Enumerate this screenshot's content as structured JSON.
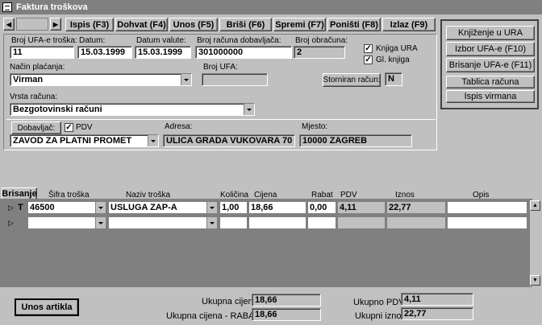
{
  "window": {
    "title": "Faktura troškova"
  },
  "toolbar": {
    "ispis": "Ispis (F3)",
    "dohvat": "Dohvat (F4)",
    "unos": "Unos (F5)",
    "brisi": "Briši (F6)",
    "spremi": "Spremi (F7)",
    "ponisti": "Poništi (F8)",
    "izlaz": "Izlaz (F9)"
  },
  "side": {
    "knjizenje": "Knjiženje u URA",
    "izbor": "Izbor UFA-e (F10)",
    "brisanje": "Brisanje UFA-e (F11)",
    "tablica": "Tablica računa",
    "ispis_virmana": "Ispis virmana"
  },
  "form": {
    "broj_ufa_label": "Broj UFA-e troška:",
    "broj_ufa": "11",
    "datum_label": "Datum:",
    "datum": "15.03.1999",
    "datum_valute_label": "Datum valute:",
    "datum_valute": "15.03.1999",
    "broj_racuna_label": "Broj računa dobavljača:",
    "broj_racuna": "301000000",
    "broj_obracuna_label": "Broj obračuna:",
    "broj_obracuna": "2",
    "knjiga_ura": "Knjiga URA",
    "gl_knjiga": "Gl. knjiga",
    "nacin_placanja_label": "Način plaćanja:",
    "nacin_placanja": "Virman",
    "broj_ufa2_label": "Broj UFA:",
    "broj_ufa2": "",
    "storniran_label": "Storniran račun:",
    "storniran": "N",
    "vrsta_racuna_label": "Vrsta računa:",
    "vrsta_racuna": "Bezgotovinski računi",
    "dobavljac_btn": "Dobavljač:",
    "pdv_chk": "PDV",
    "dobavljac": "ZAVOD ZA PLATNI PROMET",
    "adresa_label": "Adresa:",
    "adresa": "ULICA GRADA VUKOVARA 70",
    "mjesto_label": "Mjesto:",
    "mjesto": "10000 ZAGREB"
  },
  "grid": {
    "brisanje": "Brisanje",
    "headers": [
      "Šifra troška",
      "Naziv troška",
      "Količina",
      "Cijena",
      "Rabat",
      "PDV",
      "Iznos",
      "Opis"
    ],
    "rows": [
      {
        "marker": "T",
        "sifra": "46500",
        "naziv": "USLUGA ZAP-A",
        "kolicina": "1,00",
        "cijena": "18,66",
        "rabat": "0,00",
        "pdv": "4,11",
        "iznos": "22,77",
        "opis": ""
      }
    ]
  },
  "footer": {
    "unos_artikla": "Unos artikla",
    "ukupna_cijena_label": "Ukupna cijena:",
    "ukupna_cijena": "18,66",
    "ukupna_rabat_label": "Ukupna cijena - RABAT:",
    "ukupna_rabat": "18,66",
    "ukupno_pdv_label": "Ukupno PDV:",
    "ukupno_pdv": "4,11",
    "ukupni_iznos_label": "Ukupni iznos:",
    "ukupni_iznos": "22,77"
  }
}
